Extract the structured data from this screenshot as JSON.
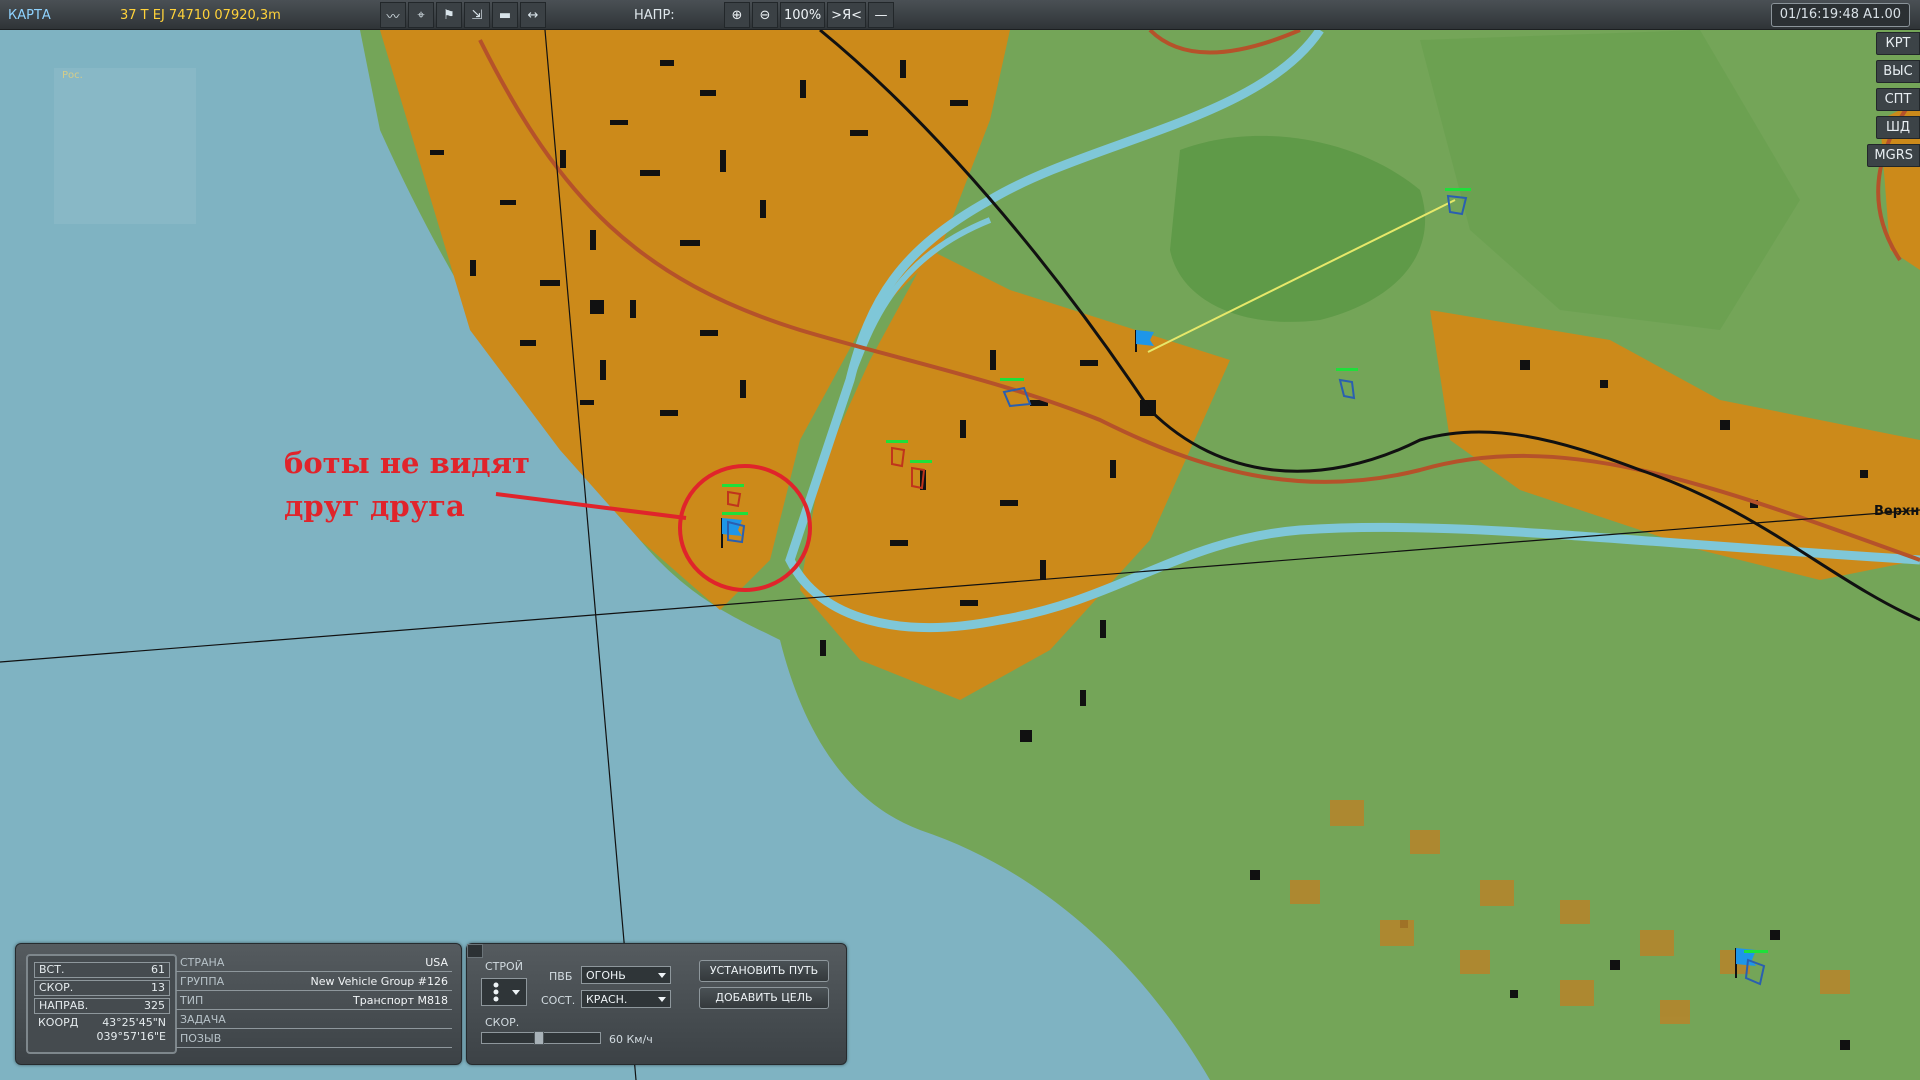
{
  "topbar": {
    "title": "КАРТА",
    "coordinates": "37 T EJ 74710 07920,3m",
    "tools": [
      {
        "icon": "route-icon",
        "glyph": "〰"
      },
      {
        "icon": "target-icon",
        "glyph": "⌖"
      },
      {
        "icon": "unit-icon",
        "glyph": "⚑"
      },
      {
        "icon": "marker-icon",
        "glyph": "⇲"
      },
      {
        "icon": "comment-icon",
        "glyph": "▬"
      },
      {
        "icon": "ruler-icon",
        "glyph": "↔"
      }
    ],
    "direction_label": "НАПР:",
    "zoom_in": "⊕",
    "zoom_out": "⊖",
    "zoom_level": "100%",
    "center_self": ">Я<",
    "dash": "—",
    "time": "01/16:19:48 A1.00"
  },
  "side_buttons": [
    "КРТ",
    "ВЫС",
    "СПТ",
    "ШД",
    "MGRS"
  ],
  "map": {
    "annotation_line1": "боты не видят",
    "annotation_line2": "друг друга",
    "place_label": "Верхне",
    "faint_label": "Рос.",
    "colors": {
      "sea": "#7fb3c2",
      "land": "#74a558",
      "forest": "#5f9a48",
      "town": "#cc8a1a",
      "river": "#7fc7d8",
      "road": "#b5522a",
      "annotation": "#e0242b"
    }
  },
  "unit_panel": {
    "stats": [
      {
        "label": "ВСТ.",
        "value": "61"
      },
      {
        "label": "СКОР.",
        "value": "13"
      },
      {
        "label": "НАПРАВ.",
        "value": "325"
      }
    ],
    "coord_label": "КООРД",
    "coord_lat": "43°25'45\"N",
    "coord_lon": "039°57'16\"E",
    "info": [
      {
        "label": "СТРАНА",
        "value": "USA"
      },
      {
        "label": "ГРУППА",
        "value": "New Vehicle Group #126"
      },
      {
        "label": "ТИП",
        "value": "Транспорт M818"
      },
      {
        "label": "ЗАДАЧА",
        "value": ""
      },
      {
        "label": "ПОЗЫВ",
        "value": ""
      }
    ]
  },
  "orders_panel": {
    "formation_label": "СТРОЙ",
    "roe_label": "ПВБ",
    "roe_value": "ОГОНЬ",
    "state_label": "СОСТ.",
    "state_value": "КРАСН.",
    "speed_label": "СКОР.",
    "speed_value": "60 Км/ч",
    "set_route_button": "УСТАНОВИТЬ ПУТЬ",
    "add_target_button": "ДОБАВИТЬ ЦЕЛЬ"
  }
}
